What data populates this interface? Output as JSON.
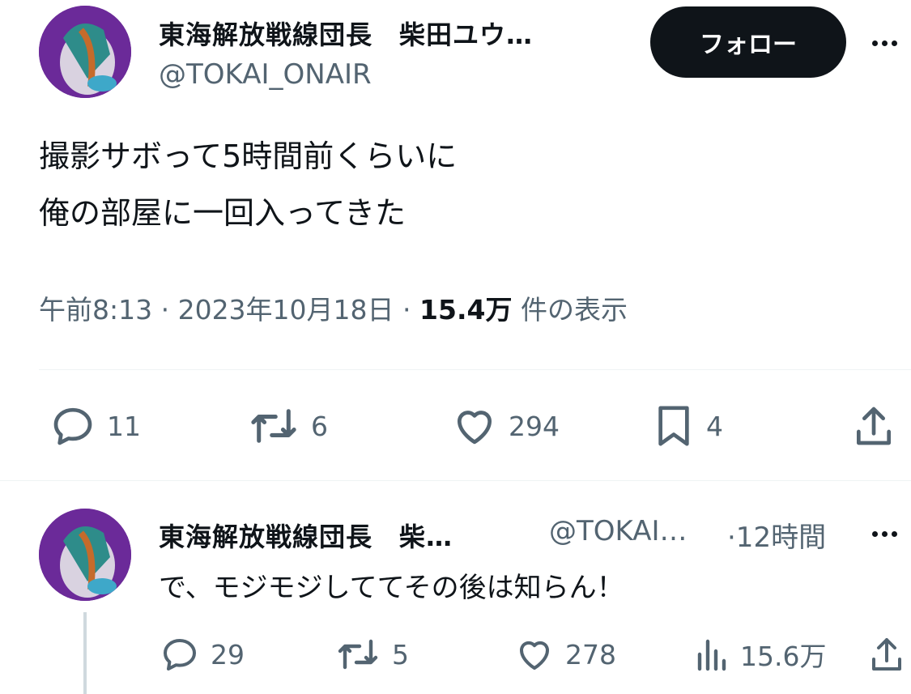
{
  "main_tweet": {
    "author_name": "東海解放戦線団長　柴田ユウ…",
    "handle": "@TOKAI_ONAIR",
    "follow_label": "フォロー",
    "text_lines": [
      "撮影サボって5時間前くらいに",
      "俺の部屋に一回入ってきた"
    ],
    "time_date": "午前8:13 · 2023年10月18日 ·",
    "views_count": "15.4万",
    "views_label": "件の表示",
    "stats": {
      "replies": "11",
      "retweets": "6",
      "likes": "294",
      "bookmarks": "4"
    }
  },
  "reply": {
    "author_name": "東海解放戦線団長　柴…",
    "handle": "@TOKAI…",
    "time": "·12時間",
    "text": "で、モジモジしててその後は知らん！",
    "stats": {
      "replies": "29",
      "retweets": "5",
      "likes": "278",
      "views": "15.6万"
    }
  },
  "icons": [
    "more-icon",
    "reply-icon",
    "retweet-icon",
    "like-icon",
    "bookmark-icon",
    "share-icon",
    "views-icon"
  ],
  "colors": {
    "text": "#0f1419",
    "muted": "#536471",
    "button_bg": "#0f1419",
    "divider": "#eff3f4"
  }
}
